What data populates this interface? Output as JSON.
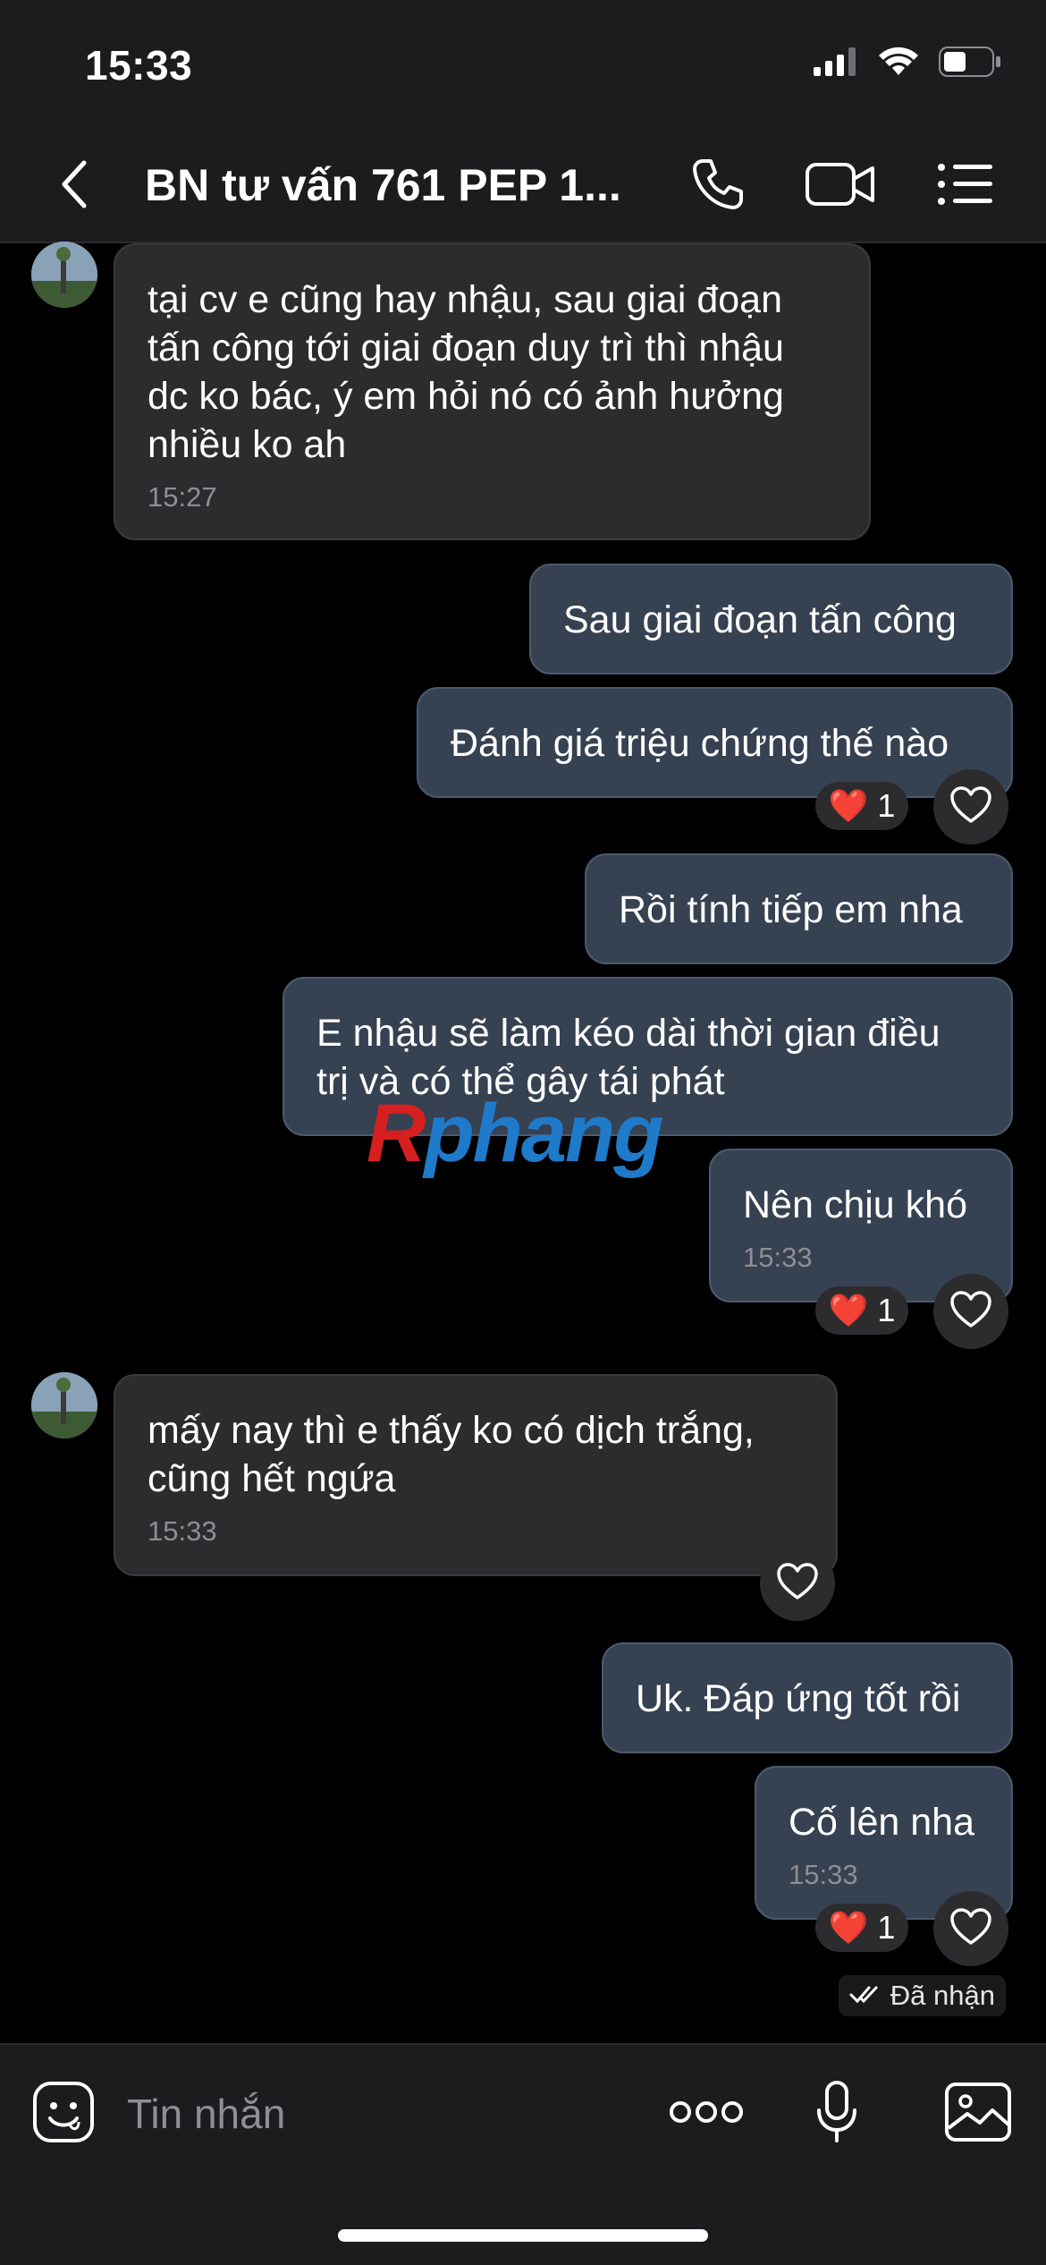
{
  "status_bar": {
    "time": "15:33",
    "icons": [
      "cellular-signal-icon",
      "wifi-icon",
      "battery-icon"
    ]
  },
  "header": {
    "title": "BN tư vấn 761 PEP 1...",
    "icons": [
      "back-icon",
      "phone-icon",
      "video-call-icon",
      "menu-list-icon"
    ]
  },
  "messages": [
    {
      "direction": "incoming",
      "text_lines": [
        "tại cv e cũng hay nhậu, sau giai đoạn",
        "tấn công tới giai đoạn duy trì thì nhậu",
        "dc ko bác, ý em hỏi nó có ảnh hưởng",
        "nhiều ko ah"
      ],
      "time": "15:27"
    },
    {
      "direction": "outgoing",
      "text": "Sau giai đoạn tấn công"
    },
    {
      "direction": "outgoing",
      "text": "Đánh giá triệu chứng thế nào",
      "reaction": {
        "emoji": "❤️",
        "count": "1"
      }
    },
    {
      "direction": "outgoing",
      "text": "Rồi tính tiếp em nha"
    },
    {
      "direction": "outgoing",
      "text_lines": [
        "E nhậu sẽ làm kéo dài thời gian điều",
        "trị và có thể gây tái phát"
      ]
    },
    {
      "direction": "outgoing",
      "text": "Nên chịu khó",
      "time": "15:33",
      "reaction": {
        "emoji": "❤️",
        "count": "1"
      }
    },
    {
      "direction": "incoming",
      "text_lines": [
        "mấy nay thì e thấy ko có dịch trắng,",
        "cũng hết ngứa"
      ],
      "time": "15:33"
    },
    {
      "direction": "outgoing",
      "text": "Uk. Đáp ứng tốt rồi"
    },
    {
      "direction": "outgoing",
      "text": "Cố lên nha",
      "time": "15:33",
      "reaction": {
        "emoji": "❤️",
        "count": "1"
      }
    }
  ],
  "receipt": {
    "label": "Đã nhận",
    "icon": "double-check-icon"
  },
  "watermark": {
    "part1": "R",
    "part2": "phang"
  },
  "input_bar": {
    "placeholder": "Tin nhắn",
    "icons": [
      "sticker-icon",
      "more-dots-icon",
      "microphone-icon",
      "image-gallery-icon"
    ]
  },
  "colors": {
    "incoming_bubble": "#2c2c2e",
    "outgoing_bubble": "#364152",
    "background": "#000000",
    "time_text": "#8e8e93"
  }
}
